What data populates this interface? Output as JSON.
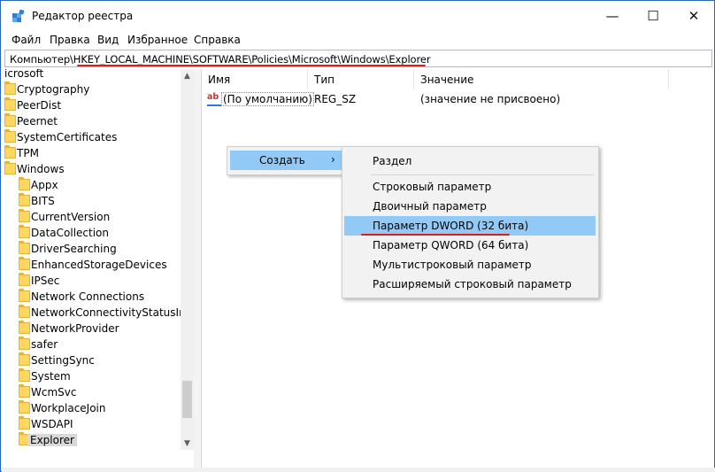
{
  "window": {
    "title": "Редактор реестра",
    "minimize_glyph": "—",
    "maximize_glyph": "☐",
    "close_glyph": "✕"
  },
  "menubar": [
    "Файл",
    "Правка",
    "Вид",
    "Избранное",
    "Справка"
  ],
  "address": {
    "path": "Компьютер\\HKEY_LOCAL_MACHINE\\SOFTWARE\\Policies\\Microsoft\\Windows\\Explorer"
  },
  "tree": {
    "items": [
      {
        "label": "icrosoft",
        "level": 0,
        "folder": false
      },
      {
        "label": "Cryptography",
        "level": 1,
        "folder": true
      },
      {
        "label": "PeerDist",
        "level": 1,
        "folder": true
      },
      {
        "label": "Peernet",
        "level": 1,
        "folder": true
      },
      {
        "label": "SystemCertificates",
        "level": 1,
        "folder": true
      },
      {
        "label": "TPM",
        "level": 1,
        "folder": true
      },
      {
        "label": "Windows",
        "level": 1,
        "folder": true
      },
      {
        "label": "Appx",
        "level": 2,
        "folder": true
      },
      {
        "label": "BITS",
        "level": 2,
        "folder": true
      },
      {
        "label": "CurrentVersion",
        "level": 2,
        "folder": true
      },
      {
        "label": "DataCollection",
        "level": 2,
        "folder": true
      },
      {
        "label": "DriverSearching",
        "level": 2,
        "folder": true
      },
      {
        "label": "EnhancedStorageDevices",
        "level": 2,
        "folder": true
      },
      {
        "label": "IPSec",
        "level": 2,
        "folder": true
      },
      {
        "label": "Network Connections",
        "level": 2,
        "folder": true
      },
      {
        "label": "NetworkConnectivityStatusIndic",
        "level": 2,
        "folder": true
      },
      {
        "label": "NetworkProvider",
        "level": 2,
        "folder": true
      },
      {
        "label": "safer",
        "level": 2,
        "folder": true
      },
      {
        "label": "SettingSync",
        "level": 2,
        "folder": true
      },
      {
        "label": "System",
        "level": 2,
        "folder": true
      },
      {
        "label": "WcmSvc",
        "level": 2,
        "folder": true
      },
      {
        "label": "WorkplaceJoin",
        "level": 2,
        "folder": true
      },
      {
        "label": "WSDAPI",
        "level": 2,
        "folder": true
      },
      {
        "label": "Explorer",
        "level": 2,
        "folder": true,
        "selected": true
      }
    ]
  },
  "list": {
    "columns": [
      "Имя",
      "Тип",
      "Значение"
    ],
    "rows": [
      {
        "icon": "ab",
        "name": "(По умолчанию)",
        "type": "REG_SZ",
        "value": "(значение не присвоено)"
      }
    ]
  },
  "context_menu": {
    "create_label": "Создать",
    "create_arrow": "›"
  },
  "submenu": {
    "items": [
      {
        "label": "Раздел"
      },
      {
        "label": "Строковый параметр"
      },
      {
        "label": "Двоичный параметр"
      },
      {
        "label": "Параметр DWORD (32 бита)",
        "highlighted": true
      },
      {
        "label": "Параметр QWORD (64 бита)"
      },
      {
        "label": "Мультистроковый параметр"
      },
      {
        "label": "Расширяемый строковый параметр"
      }
    ]
  },
  "colors": {
    "selection_blue": "#91c9f7",
    "annotation_red": "#e21b1b",
    "folder_yellow": "#ffd75e"
  }
}
